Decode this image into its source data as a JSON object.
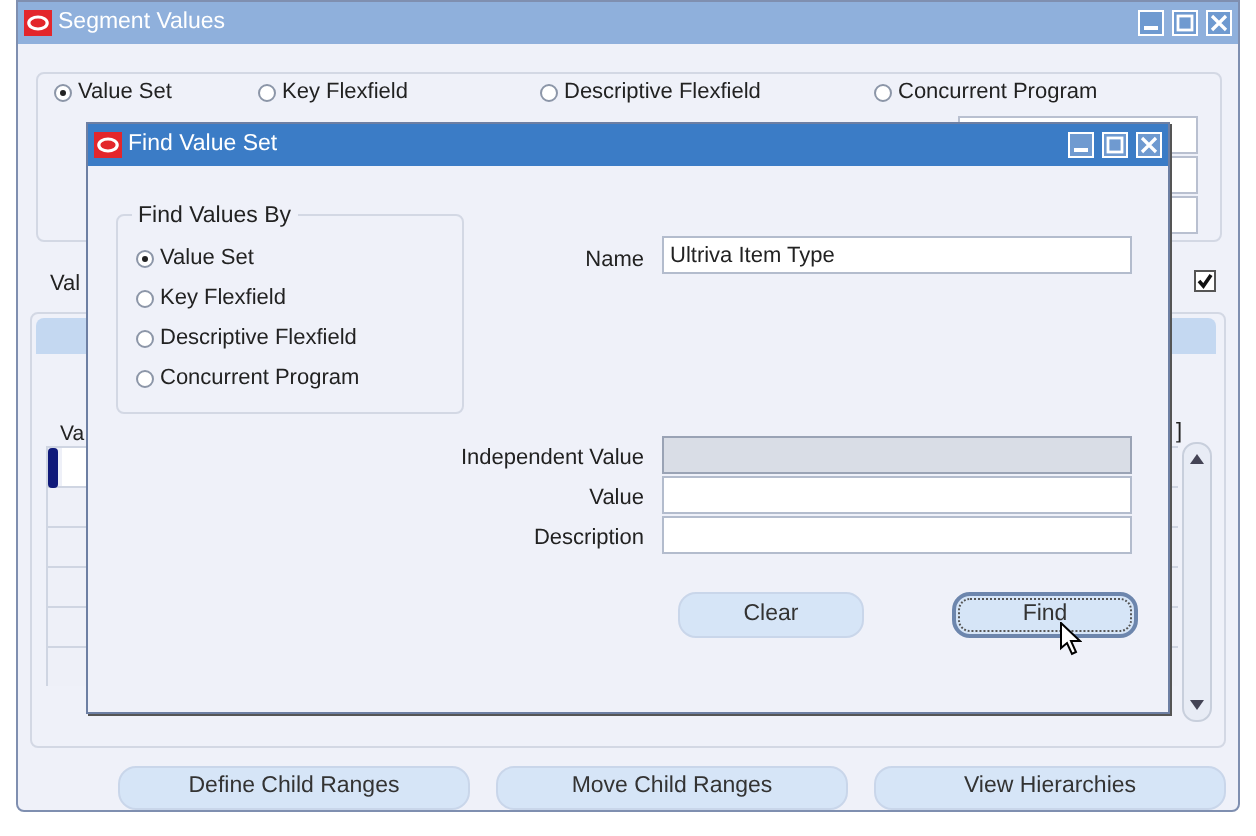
{
  "window": {
    "title": "Segment Values"
  },
  "source_options": [
    {
      "label": "Value Set",
      "selected": true
    },
    {
      "label": "Key Flexfield",
      "selected": false
    },
    {
      "label": "Descriptive Flexfield",
      "selected": false
    },
    {
      "label": "Concurrent Program",
      "selected": false
    }
  ],
  "section": {
    "label": "Val",
    "checked": true
  },
  "grid": {
    "column_label": "Va",
    "bracket": "]"
  },
  "buttons": [
    "Define Child Ranges",
    "Move Child Ranges",
    "View Hierarchies"
  ],
  "dialog": {
    "title": "Find Value Set",
    "group_label": "Find Values By",
    "options": [
      {
        "label": "Value Set",
        "selected": true
      },
      {
        "label": "Key Flexfield",
        "selected": false
      },
      {
        "label": "Descriptive Flexfield",
        "selected": false
      },
      {
        "label": "Concurrent Program",
        "selected": false
      }
    ],
    "name_field": {
      "label": "Name",
      "value": "Ultriva Item Type"
    },
    "fields": [
      {
        "label": "Independent Value",
        "disabled": true
      },
      {
        "label": "Value",
        "disabled": false
      },
      {
        "label": "Description",
        "disabled": false
      }
    ],
    "buttons": [
      {
        "label": "Clear",
        "focused": false
      },
      {
        "label": "Find",
        "focused": true
      }
    ]
  }
}
